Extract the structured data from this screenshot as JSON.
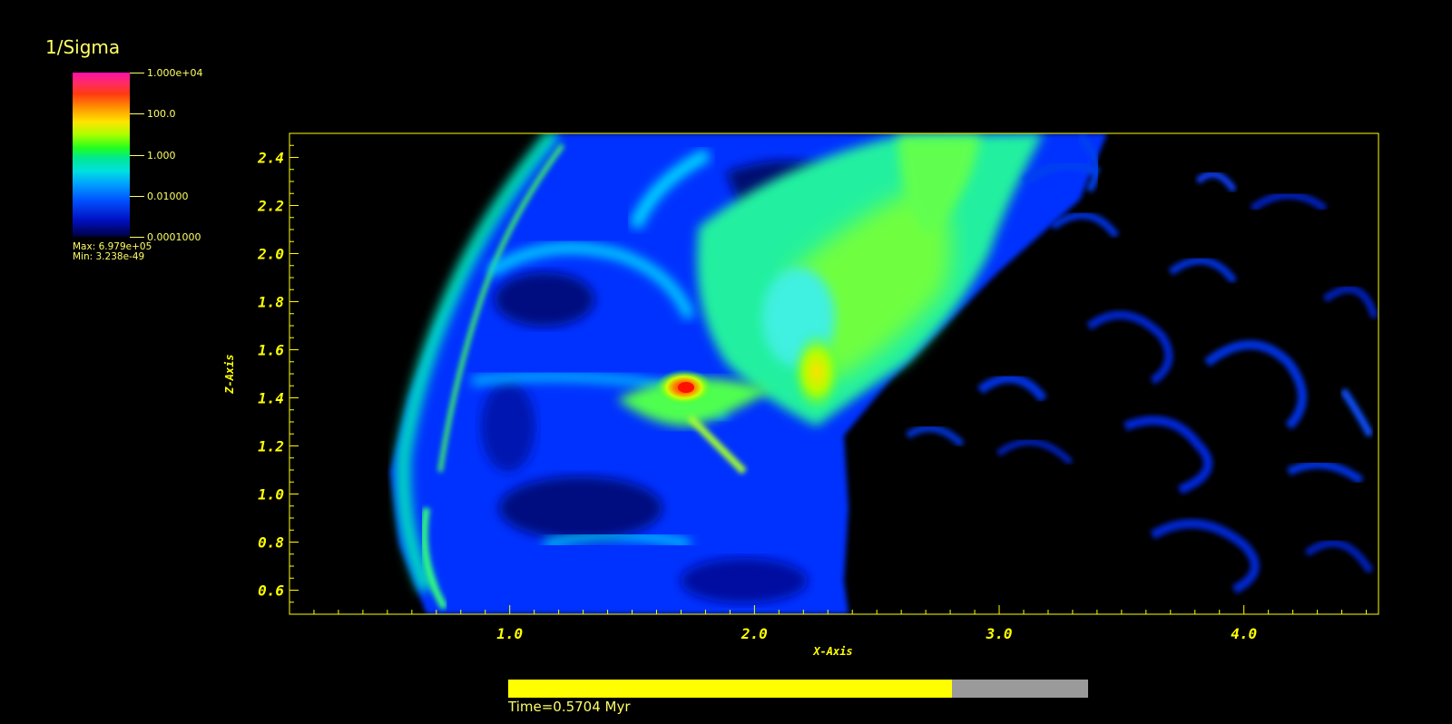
{
  "legend": {
    "title": "1/Sigma",
    "ticks": [
      "1.000e+04",
      "100.0",
      "1.000",
      "0.01000",
      "0.0001000"
    ],
    "max_label": "Max:  6.979e+05",
    "min_label": "Min:  3.238e-49"
  },
  "chart_data": {
    "type": "heatmap",
    "xlabel": "X-Axis",
    "ylabel": "Z-Axis",
    "xlim": [
      0.1,
      4.55
    ],
    "ylim": [
      0.5,
      2.5
    ],
    "x_ticks": [
      "1.0",
      "2.0",
      "3.0",
      "4.0"
    ],
    "y_ticks": [
      "0.6",
      "0.8",
      "1.0",
      "1.2",
      "1.4",
      "1.6",
      "1.8",
      "2.0",
      "2.2",
      "2.4"
    ],
    "colorbar": {
      "scale": "log",
      "range": [
        0.0001,
        10000
      ]
    },
    "peak_location": {
      "x": 1.68,
      "z": 1.45
    }
  },
  "time": {
    "label": "Time=0.5704 Myr",
    "progress": 0.765
  },
  "colors": {
    "axis": "#ffff00",
    "background": "#000000",
    "progress_track": "#9a9a9a"
  }
}
